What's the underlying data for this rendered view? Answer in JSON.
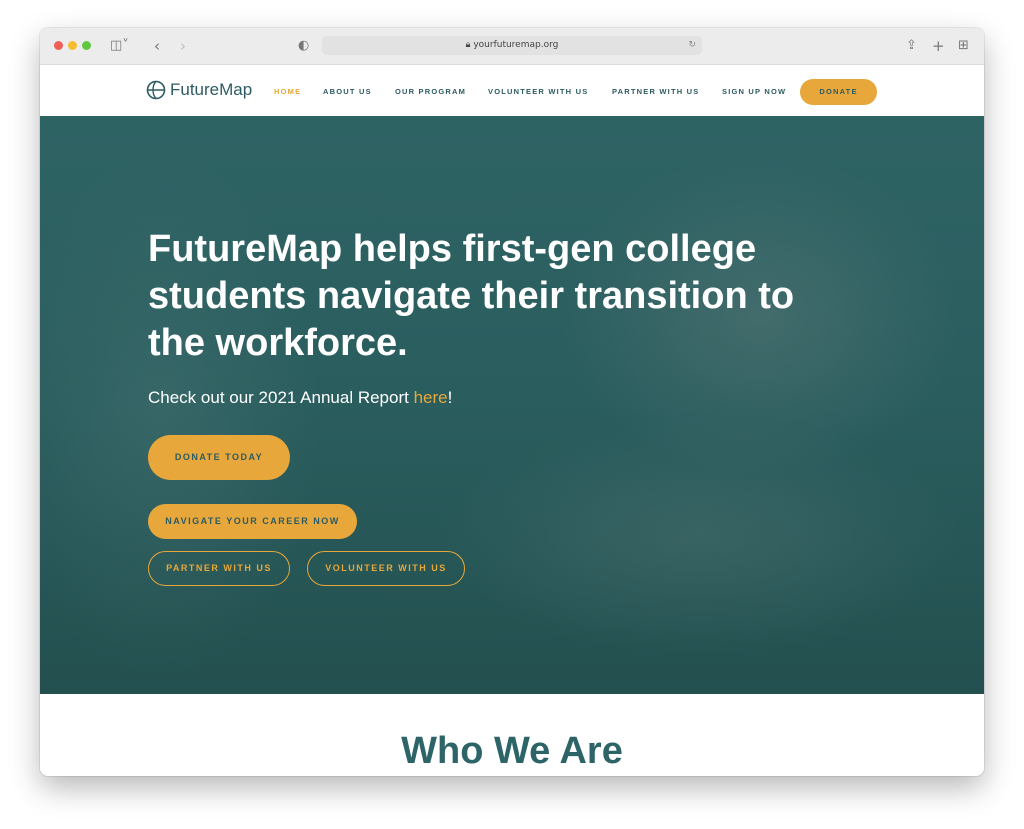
{
  "browser": {
    "url": "yourfuturemap.org"
  },
  "nav": {
    "logo": "FutureMap",
    "items": [
      "HOME",
      "ABOUT US",
      "OUR PROGRAM",
      "VOLUNTEER WITH US",
      "PARTNER WITH US",
      "SIGN UP NOW"
    ],
    "donate": "DONATE"
  },
  "hero": {
    "headline": "FutureMap helps first-gen college students navigate their transition to the workforce.",
    "report_prefix": "Check out our 2021 Annual Report ",
    "report_link": "here",
    "report_suffix": "!",
    "buttons": {
      "donate": "DONATE TODAY",
      "career": "NAVIGATE YOUR CAREER NOW",
      "partner": "PARTNER WITH US",
      "volunteer": "VOLUNTEER WITH US"
    }
  },
  "section": {
    "title": "Who We Are"
  },
  "colors": {
    "accent": "#e8a73a",
    "brand": "#2d5b62"
  }
}
